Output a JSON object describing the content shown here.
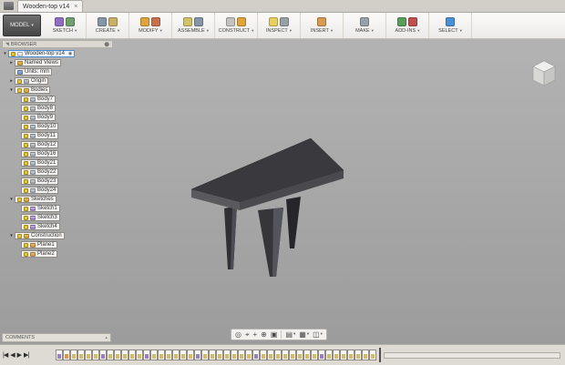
{
  "tab_bar": {
    "tab_title": "Wooden-top v14",
    "close_glyph": "×"
  },
  "toolbar": {
    "model_label": "MODEL",
    "menus": [
      {
        "label": "SKETCH",
        "icon_colors": [
          "#8e6fc0",
          "#6f9e6f"
        ]
      },
      {
        "label": "CREATE",
        "icon_colors": [
          "#8596a8",
          "#c8b06a"
        ]
      },
      {
        "label": "MODIFY",
        "icon_colors": [
          "#e0a43c",
          "#c87050"
        ]
      },
      {
        "label": "ASSEMBLE",
        "icon_colors": [
          "#d2c26a",
          "#8596a8"
        ]
      },
      {
        "label": "CONSTRUCT",
        "icon_colors": [
          "#c2c2c0",
          "#e0a43c"
        ]
      },
      {
        "label": "INSPECT",
        "icon_colors": [
          "#e8d060",
          "#9aa0a8"
        ]
      },
      {
        "label": "INSERT",
        "icon_colors": [
          "#d89a50"
        ]
      },
      {
        "label": "MAKE",
        "icon_colors": [
          "#9aa0a8"
        ]
      },
      {
        "label": "ADD-INS",
        "icon_colors": [
          "#5b9e5b",
          "#c05050"
        ]
      },
      {
        "label": "SELECT",
        "icon_colors": [
          "#4a90d9"
        ]
      }
    ]
  },
  "browser": {
    "title": "BROWSER",
    "tree": [
      {
        "label": "Wooden-top v14",
        "level": 0,
        "expandable": true,
        "expanded": true,
        "icon": "doc",
        "bulb": true,
        "root": true,
        "radio": true
      },
      {
        "label": "Named Views",
        "level": 1,
        "expandable": true,
        "expanded": false,
        "icon": "folder",
        "bulb": false
      },
      {
        "label": "Units: mm",
        "level": 1,
        "expandable": false,
        "expanded": false,
        "icon": "units",
        "bulb": false
      },
      {
        "label": "Origin",
        "level": 1,
        "expandable": true,
        "expanded": false,
        "icon": "origin",
        "bulb": true
      },
      {
        "label": "Bodies",
        "level": 1,
        "expandable": true,
        "expanded": true,
        "icon": "folder",
        "bulb": true
      },
      {
        "label": "Body7",
        "level": 2,
        "icon": "body",
        "bulb": true
      },
      {
        "label": "Body8",
        "level": 2,
        "icon": "body",
        "bulb": true
      },
      {
        "label": "Body9",
        "level": 2,
        "icon": "body",
        "bulb": true
      },
      {
        "label": "Body10",
        "level": 2,
        "icon": "body",
        "bulb": true
      },
      {
        "label": "Body11",
        "level": 2,
        "icon": "body",
        "bulb": true
      },
      {
        "label": "Body12",
        "level": 2,
        "icon": "body",
        "bulb": true
      },
      {
        "label": "Body16",
        "level": 2,
        "icon": "body",
        "bulb": true
      },
      {
        "label": "Body21",
        "level": 2,
        "icon": "body",
        "bulb": true
      },
      {
        "label": "Body22",
        "level": 2,
        "icon": "body",
        "bulb": true
      },
      {
        "label": "Body23",
        "level": 2,
        "icon": "body",
        "bulb": true
      },
      {
        "label": "Body24",
        "level": 2,
        "icon": "body",
        "bulb": true
      },
      {
        "label": "Sketches",
        "level": 1,
        "expandable": true,
        "expanded": true,
        "icon": "folder",
        "bulb": true
      },
      {
        "label": "Sketch1",
        "level": 2,
        "icon": "sketch",
        "bulb": true
      },
      {
        "label": "Sketch3",
        "level": 2,
        "icon": "sketch",
        "bulb": true
      },
      {
        "label": "Sketch4",
        "level": 2,
        "icon": "sketch",
        "bulb": true
      },
      {
        "label": "Construction",
        "level": 1,
        "expandable": true,
        "expanded": true,
        "icon": "folder",
        "bulb": true
      },
      {
        "label": "Plane1",
        "level": 2,
        "icon": "plane",
        "bulb": true
      },
      {
        "label": "Plane2",
        "level": 2,
        "icon": "plane",
        "bulb": true
      }
    ]
  },
  "comments": {
    "label": "COMMENTS"
  },
  "view_toolbar": {
    "buttons": [
      {
        "name": "orbit",
        "glyph": "◎"
      },
      {
        "name": "look-at",
        "glyph": "⌖"
      },
      {
        "name": "pan",
        "glyph": "+"
      },
      {
        "name": "zoom",
        "glyph": "⊕"
      },
      {
        "name": "fit",
        "glyph": "▣"
      },
      {
        "name": "display-settings",
        "glyph": "▤",
        "dropdown": true
      },
      {
        "name": "grid-and-snaps",
        "glyph": "▦",
        "dropdown": true
      },
      {
        "name": "viewports",
        "glyph": "◫",
        "dropdown": true
      }
    ]
  },
  "timeline": {
    "controls": [
      {
        "name": "skip-to-start",
        "glyph": "|◀"
      },
      {
        "name": "step-back",
        "glyph": "◀"
      },
      {
        "name": "play",
        "glyph": "▶"
      },
      {
        "name": "skip-to-end",
        "glyph": "▶|"
      }
    ],
    "features": [
      "sketch",
      "plane",
      "loft",
      "loft",
      "loft",
      "loft",
      "sketch",
      "loft",
      "loft",
      "loft",
      "loft",
      "loft",
      "sketch",
      "loft",
      "loft",
      "loft",
      "loft",
      "loft",
      "loft",
      "sketch",
      "loft",
      "loft",
      "loft",
      "loft",
      "loft",
      "loft",
      "loft",
      "sketch",
      "loft",
      "loft",
      "loft",
      "loft",
      "loft",
      "loft",
      "loft",
      "loft",
      "sketch",
      "loft",
      "loft",
      "loft",
      "loft",
      "loft",
      "loft",
      "loft"
    ],
    "colors": {
      "sketch": "#9b7fc0",
      "loft": "#d9b96a",
      "plane": "#e0953c"
    }
  }
}
